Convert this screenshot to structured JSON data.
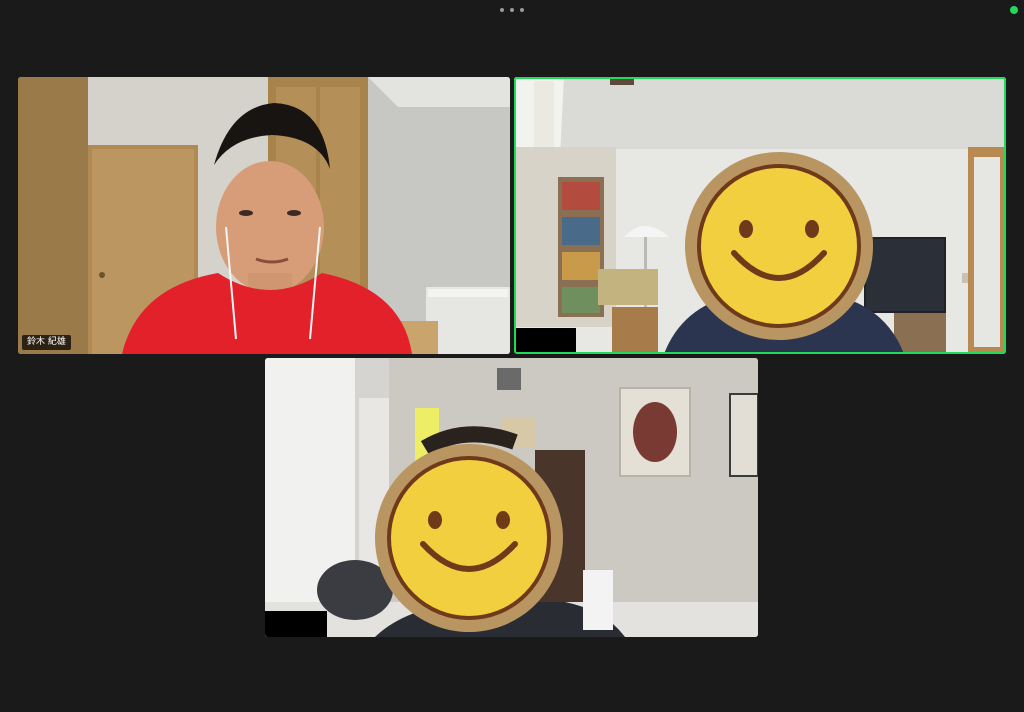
{
  "meeting": {
    "toolbar": {
      "more_icon": "more-horizontal-icon"
    },
    "status": {
      "recording_color": "#23d959"
    },
    "active_speaker_color": "#23d959"
  },
  "participants": [
    {
      "name": "鈴木 紀雄",
      "video_on": true,
      "active_speaker": false
    },
    {
      "name": "",
      "video_on": true,
      "active_speaker": true,
      "face_covered_with": "smiley-sticker"
    },
    {
      "name": "",
      "video_on": true,
      "active_speaker": false,
      "face_covered_with": "smiley-sticker"
    }
  ]
}
